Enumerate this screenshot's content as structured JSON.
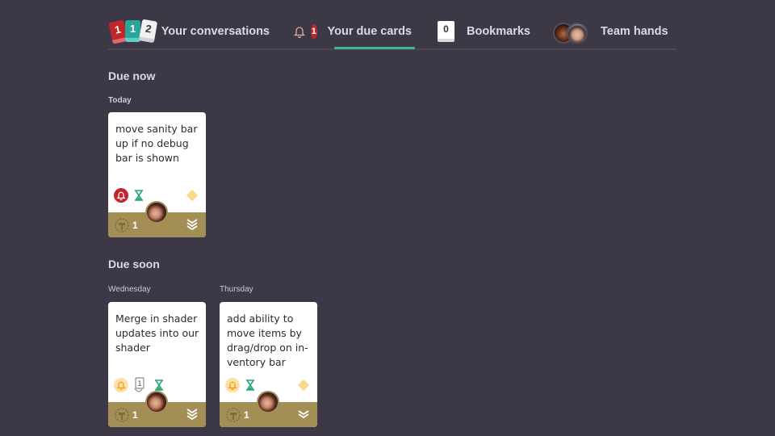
{
  "nav": {
    "tabs": [
      {
        "label": "Your conversations",
        "icon": "card-stack-icon",
        "cards": [
          "1",
          "1",
          "2"
        ],
        "active": false
      },
      {
        "label": "Your due cards",
        "icon": "bell-icon",
        "badge": "1",
        "active": true
      },
      {
        "label": "Bookmarks",
        "icon": "bookmark-card-icon",
        "count": "0",
        "active": false
      },
      {
        "label": "Team hands",
        "icon": "team-avatars-icon",
        "active": false
      }
    ]
  },
  "colors": {
    "background": "#3c3845",
    "accent": "#3fb58c",
    "alert": "#c1262e",
    "card_footer": "#a38f55",
    "priority": "#f9d98c"
  },
  "sections": [
    {
      "title": "Due now",
      "groups": [
        {
          "day": "Today",
          "cards": [
            {
              "title": "move sanity bar up if no debug bar is shown",
              "bell": "overdue",
              "hourglass": true,
              "priority": true,
              "effort": "1",
              "checklist": null
            }
          ]
        }
      ]
    },
    {
      "title": "Due soon",
      "groups": [
        {
          "day": "Wednesday",
          "cards": [
            {
              "title": "Merge in shader updates into our shader",
              "bell": "upcoming",
              "hourglass": true,
              "priority": false,
              "effort": "1",
              "checklist": "1"
            }
          ]
        },
        {
          "day": "Thursday",
          "cards": [
            {
              "title": "add ability to move items by drag/drop on in-ventory bar",
              "bell": "upcoming",
              "hourglass": true,
              "priority": true,
              "effort": "1",
              "checklist": null
            }
          ]
        }
      ]
    }
  ]
}
